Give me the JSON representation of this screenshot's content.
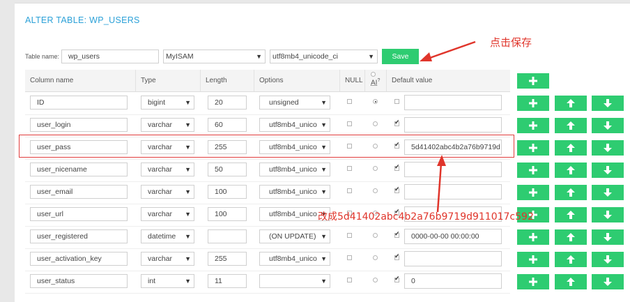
{
  "page": {
    "title": "ALTER TABLE: WP_USERS"
  },
  "table_name": {
    "label": "Table name:",
    "value": "wp_users",
    "engine": "MyISAM",
    "collation": "utf8mb4_unicode_ci",
    "save_label": "Save"
  },
  "columns_header": {
    "name": "Column name",
    "type": "Type",
    "length": "Length",
    "options": "Options",
    "null": "NULL",
    "ai": "AI",
    "ai_sup": "?",
    "default": "Default value"
  },
  "rows": [
    {
      "name": "ID",
      "type": "bigint",
      "length": "20",
      "options": "unsigned",
      "null": false,
      "ai": true,
      "default_cb": false,
      "default": ""
    },
    {
      "name": "user_login",
      "type": "varchar",
      "length": "60",
      "options": "utf8mb4_unico",
      "null": false,
      "ai": false,
      "default_cb": true,
      "default": ""
    },
    {
      "name": "user_pass",
      "type": "varchar",
      "length": "255",
      "options": "utf8mb4_unico",
      "null": false,
      "ai": false,
      "default_cb": true,
      "default": "5d41402abc4b2a76b9719d"
    },
    {
      "name": "user_nicename",
      "type": "varchar",
      "length": "50",
      "options": "utf8mb4_unico",
      "null": false,
      "ai": false,
      "default_cb": true,
      "default": ""
    },
    {
      "name": "user_email",
      "type": "varchar",
      "length": "100",
      "options": "utf8mb4_unico",
      "null": false,
      "ai": false,
      "default_cb": true,
      "default": ""
    },
    {
      "name": "user_url",
      "type": "varchar",
      "length": "100",
      "options": "utf8mb4_unico",
      "null": false,
      "ai": false,
      "default_cb": true,
      "default": ""
    },
    {
      "name": "user_registered",
      "type": "datetime",
      "length": "",
      "options": "(ON UPDATE)",
      "null": false,
      "ai": false,
      "default_cb": true,
      "default": "0000-00-00 00:00:00"
    },
    {
      "name": "user_activation_key",
      "type": "varchar",
      "length": "255",
      "options": "utf8mb4_unico",
      "null": false,
      "ai": false,
      "default_cb": true,
      "default": ""
    },
    {
      "name": "user_status",
      "type": "int",
      "length": "11",
      "options": "",
      "null": false,
      "ai": false,
      "default_cb": true,
      "default": "0"
    }
  ],
  "annotations": {
    "click_save": "点击保存",
    "change_to": "改成5d41402abc4b2a76b9719d911017c592"
  },
  "colors": {
    "accent": "#2ecc71",
    "title": "#2ca1d8",
    "annotation": "#e0352b"
  },
  "icons": {
    "add": "plus-icon",
    "up": "arrow-up-icon",
    "down": "arrow-down-icon"
  }
}
